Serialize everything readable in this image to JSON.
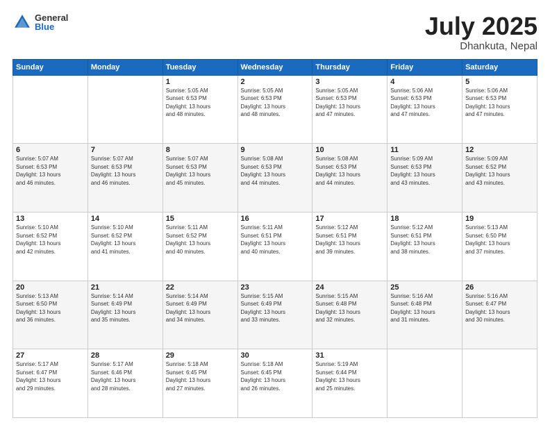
{
  "header": {
    "logo_general": "General",
    "logo_blue": "Blue",
    "month": "July 2025",
    "location": "Dhankuta, Nepal"
  },
  "days_of_week": [
    "Sunday",
    "Monday",
    "Tuesday",
    "Wednesday",
    "Thursday",
    "Friday",
    "Saturday"
  ],
  "weeks": [
    [
      {
        "day": "",
        "info": ""
      },
      {
        "day": "",
        "info": ""
      },
      {
        "day": "1",
        "info": "Sunrise: 5:05 AM\nSunset: 6:53 PM\nDaylight: 13 hours\nand 48 minutes."
      },
      {
        "day": "2",
        "info": "Sunrise: 5:05 AM\nSunset: 6:53 PM\nDaylight: 13 hours\nand 48 minutes."
      },
      {
        "day": "3",
        "info": "Sunrise: 5:05 AM\nSunset: 6:53 PM\nDaylight: 13 hours\nand 47 minutes."
      },
      {
        "day": "4",
        "info": "Sunrise: 5:06 AM\nSunset: 6:53 PM\nDaylight: 13 hours\nand 47 minutes."
      },
      {
        "day": "5",
        "info": "Sunrise: 5:06 AM\nSunset: 6:53 PM\nDaylight: 13 hours\nand 47 minutes."
      }
    ],
    [
      {
        "day": "6",
        "info": "Sunrise: 5:07 AM\nSunset: 6:53 PM\nDaylight: 13 hours\nand 46 minutes."
      },
      {
        "day": "7",
        "info": "Sunrise: 5:07 AM\nSunset: 6:53 PM\nDaylight: 13 hours\nand 46 minutes."
      },
      {
        "day": "8",
        "info": "Sunrise: 5:07 AM\nSunset: 6:53 PM\nDaylight: 13 hours\nand 45 minutes."
      },
      {
        "day": "9",
        "info": "Sunrise: 5:08 AM\nSunset: 6:53 PM\nDaylight: 13 hours\nand 44 minutes."
      },
      {
        "day": "10",
        "info": "Sunrise: 5:08 AM\nSunset: 6:53 PM\nDaylight: 13 hours\nand 44 minutes."
      },
      {
        "day": "11",
        "info": "Sunrise: 5:09 AM\nSunset: 6:53 PM\nDaylight: 13 hours\nand 43 minutes."
      },
      {
        "day": "12",
        "info": "Sunrise: 5:09 AM\nSunset: 6:52 PM\nDaylight: 13 hours\nand 43 minutes."
      }
    ],
    [
      {
        "day": "13",
        "info": "Sunrise: 5:10 AM\nSunset: 6:52 PM\nDaylight: 13 hours\nand 42 minutes."
      },
      {
        "day": "14",
        "info": "Sunrise: 5:10 AM\nSunset: 6:52 PM\nDaylight: 13 hours\nand 41 minutes."
      },
      {
        "day": "15",
        "info": "Sunrise: 5:11 AM\nSunset: 6:52 PM\nDaylight: 13 hours\nand 40 minutes."
      },
      {
        "day": "16",
        "info": "Sunrise: 5:11 AM\nSunset: 6:51 PM\nDaylight: 13 hours\nand 40 minutes."
      },
      {
        "day": "17",
        "info": "Sunrise: 5:12 AM\nSunset: 6:51 PM\nDaylight: 13 hours\nand 39 minutes."
      },
      {
        "day": "18",
        "info": "Sunrise: 5:12 AM\nSunset: 6:51 PM\nDaylight: 13 hours\nand 38 minutes."
      },
      {
        "day": "19",
        "info": "Sunrise: 5:13 AM\nSunset: 6:50 PM\nDaylight: 13 hours\nand 37 minutes."
      }
    ],
    [
      {
        "day": "20",
        "info": "Sunrise: 5:13 AM\nSunset: 6:50 PM\nDaylight: 13 hours\nand 36 minutes."
      },
      {
        "day": "21",
        "info": "Sunrise: 5:14 AM\nSunset: 6:49 PM\nDaylight: 13 hours\nand 35 minutes."
      },
      {
        "day": "22",
        "info": "Sunrise: 5:14 AM\nSunset: 6:49 PM\nDaylight: 13 hours\nand 34 minutes."
      },
      {
        "day": "23",
        "info": "Sunrise: 5:15 AM\nSunset: 6:49 PM\nDaylight: 13 hours\nand 33 minutes."
      },
      {
        "day": "24",
        "info": "Sunrise: 5:15 AM\nSunset: 6:48 PM\nDaylight: 13 hours\nand 32 minutes."
      },
      {
        "day": "25",
        "info": "Sunrise: 5:16 AM\nSunset: 6:48 PM\nDaylight: 13 hours\nand 31 minutes."
      },
      {
        "day": "26",
        "info": "Sunrise: 5:16 AM\nSunset: 6:47 PM\nDaylight: 13 hours\nand 30 minutes."
      }
    ],
    [
      {
        "day": "27",
        "info": "Sunrise: 5:17 AM\nSunset: 6:47 PM\nDaylight: 13 hours\nand 29 minutes."
      },
      {
        "day": "28",
        "info": "Sunrise: 5:17 AM\nSunset: 6:46 PM\nDaylight: 13 hours\nand 28 minutes."
      },
      {
        "day": "29",
        "info": "Sunrise: 5:18 AM\nSunset: 6:45 PM\nDaylight: 13 hours\nand 27 minutes."
      },
      {
        "day": "30",
        "info": "Sunrise: 5:18 AM\nSunset: 6:45 PM\nDaylight: 13 hours\nand 26 minutes."
      },
      {
        "day": "31",
        "info": "Sunrise: 5:19 AM\nSunset: 6:44 PM\nDaylight: 13 hours\nand 25 minutes."
      },
      {
        "day": "",
        "info": ""
      },
      {
        "day": "",
        "info": ""
      }
    ]
  ]
}
